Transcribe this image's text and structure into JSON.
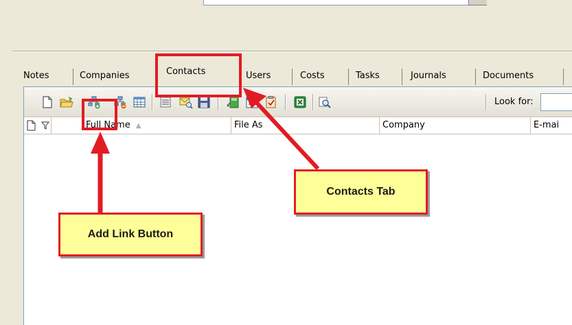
{
  "tabs": [
    "Notes",
    "Companies",
    "Contacts",
    "Users",
    "Costs",
    "Tasks",
    "Journals",
    "Documents"
  ],
  "active_tab": "Contacts",
  "toolbar": {
    "look_for_label": "Look for:",
    "buttons": [
      "new-document-icon",
      "open-folder-icon",
      "add-link-icon",
      "remove-link-icon",
      "table-view-icon",
      "list-view-icon",
      "email-search-icon",
      "save-icon",
      "note-icon",
      "calendar-icon",
      "task-icon",
      "excel-icon",
      "find-icon"
    ]
  },
  "grid": {
    "columns": [
      "Full Name",
      "File As",
      "Company",
      "E-mai"
    ]
  },
  "callouts": {
    "contacts_tab": "Contacts Tab",
    "add_link_button": "Add Link Button"
  },
  "colors": {
    "highlight": "#e21b23",
    "callout_bg": "#ffff99",
    "window_bg": "#ece9d8"
  }
}
